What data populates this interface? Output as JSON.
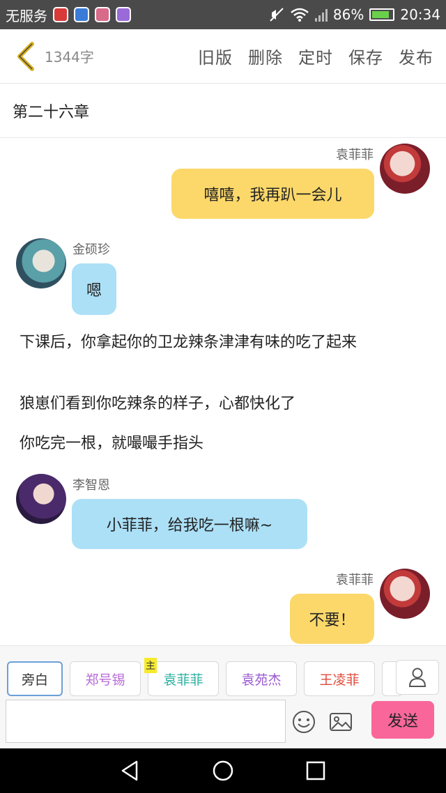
{
  "statusbar": {
    "carrier": "无服务",
    "battery_pct": "86%",
    "battery_level": 0.86,
    "time": "20:34",
    "app_icon_colors": [
      "#d83a3a",
      "#3a7bd8",
      "#d86a8a",
      "#9a6ad8"
    ]
  },
  "header": {
    "word_count": "1344字",
    "actions": [
      "旧版",
      "删除",
      "定时",
      "保存",
      "发布"
    ]
  },
  "chapter_title": "第二十六章",
  "messages": [
    {
      "speaker": "袁菲菲",
      "text": "嘻嘻，我再趴一会儿",
      "side": "right",
      "color": "#fcd86a"
    },
    {
      "speaker": "金硕珍",
      "text": "嗯",
      "side": "left",
      "color": "#ace0f6"
    }
  ],
  "narration": [
    "下课后，你拿起你的卫龙辣条津津有味的吃了起来",
    "狼崽们看到你吃辣条的样子，心都快化了",
    "你吃完一根，就嘬嘬手指头"
  ],
  "messages2": [
    {
      "speaker": "李智恩",
      "text": "小菲菲，给我吃一根嘛~",
      "side": "left",
      "color": "#ace0f6"
    },
    {
      "speaker": "袁菲菲",
      "text": "不要！",
      "side": "right",
      "color": "#fcd86a"
    }
  ],
  "characters": [
    {
      "label": "旁白",
      "color": "#333333",
      "active": true
    },
    {
      "label": "郑号锡",
      "color": "#b86ad8",
      "active": false
    },
    {
      "label": "袁菲菲",
      "color": "#2ab0a0",
      "active": false,
      "tag": "主"
    },
    {
      "label": "袁苑杰",
      "color": "#9a5ad0",
      "active": false
    },
    {
      "label": "王凌菲",
      "color": "#e04a3a",
      "active": false
    }
  ],
  "input": {
    "value": "",
    "placeholder": ""
  },
  "send_label": "发送",
  "icons": {
    "back": "chevron-left-icon",
    "user": "user-icon",
    "emoji": "smiley-icon",
    "image": "image-icon",
    "nav_back": "triangle-back-icon",
    "nav_home": "circle-home-icon",
    "nav_recent": "square-recent-icon"
  }
}
